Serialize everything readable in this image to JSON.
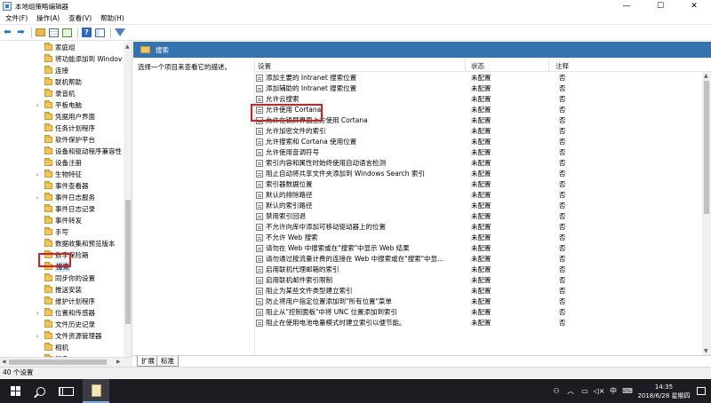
{
  "window": {
    "title": "本地组策略编辑器",
    "controls": {
      "minimize": "—",
      "maximize": "☐",
      "close": "✕"
    }
  },
  "menu": [
    "文件(F)",
    "操作(A)",
    "查看(V)",
    "帮助(H)"
  ],
  "tree": {
    "items": [
      {
        "label": "家庭组",
        "expandable": false
      },
      {
        "label": "将功能添加到 Windov",
        "expandable": false
      },
      {
        "label": "连接",
        "expandable": false
      },
      {
        "label": "联机帮助",
        "expandable": false
      },
      {
        "label": "录音机",
        "expandable": false
      },
      {
        "label": "平板电脑",
        "expandable": true
      },
      {
        "label": "凭据用户界面",
        "expandable": false
      },
      {
        "label": "任务计划程序",
        "expandable": false
      },
      {
        "label": "软件保护平台",
        "expandable": false
      },
      {
        "label": "设备和驱动程序兼容性",
        "expandable": false
      },
      {
        "label": "设备注册",
        "expandable": false
      },
      {
        "label": "生物特征",
        "expandable": true
      },
      {
        "label": "事件查看器",
        "expandable": false
      },
      {
        "label": "事件日志服务",
        "expandable": true
      },
      {
        "label": "事件日志记录",
        "expandable": false
      },
      {
        "label": "事件转发",
        "expandable": false
      },
      {
        "label": "手写",
        "expandable": false
      },
      {
        "label": "数据收集和预览版本",
        "expandable": false
      },
      {
        "label": "数字保险箱",
        "expandable": false
      },
      {
        "label": "搜索",
        "expandable": false,
        "selected": true
      },
      {
        "label": "同步你的设置",
        "expandable": false
      },
      {
        "label": "推送安装",
        "expandable": false
      },
      {
        "label": "维护计划程序",
        "expandable": false
      },
      {
        "label": "位置和传感器",
        "expandable": true
      },
      {
        "label": "文件历史记录",
        "expandable": false
      },
      {
        "label": "文件资源管理器",
        "expandable": true
      },
      {
        "label": "相机",
        "expandable": false
      },
      {
        "label": "消息",
        "expandable": false
      }
    ]
  },
  "right": {
    "header_title": "搜索",
    "description": "选择一个项目来查看它的描述。",
    "columns": {
      "name": "设置",
      "state": "状态",
      "note": "注释"
    },
    "policies": [
      {
        "name": "添加主要的 Intranet 搜索位置",
        "state": "未配置",
        "note": "否"
      },
      {
        "name": "添加辅助的 Intranet 搜索位置",
        "state": "未配置",
        "note": "否"
      },
      {
        "name": "允许云搜索",
        "state": "未配置",
        "note": "否"
      },
      {
        "name": "允许使用 Cortana",
        "state": "未配置",
        "note": "否"
      },
      {
        "name": "允许在锁屏界面上方使用 Cortana",
        "state": "未配置",
        "note": "否"
      },
      {
        "name": "允许加密文件的索引",
        "state": "未配置",
        "note": "否"
      },
      {
        "name": "允许搜索和 Cortana 使用位置",
        "state": "未配置",
        "note": "否"
      },
      {
        "name": "允许使用音调符号",
        "state": "未配置",
        "note": "否"
      },
      {
        "name": "索引内容和属性时始终使用自动语言检测",
        "state": "未配置",
        "note": "否"
      },
      {
        "name": "阻止自动将共享文件夹添加到 Windows Search 索引",
        "state": "未配置",
        "note": "否"
      },
      {
        "name": "索引器数据位置",
        "state": "未配置",
        "note": "否"
      },
      {
        "name": "默认的排除路径",
        "state": "未配置",
        "note": "否"
      },
      {
        "name": "默认的索引路径",
        "state": "未配置",
        "note": "否"
      },
      {
        "name": "禁用索引回退",
        "state": "未配置",
        "note": "否"
      },
      {
        "name": "不允许向库中添加可移动驱动器上的位置",
        "state": "未配置",
        "note": "否"
      },
      {
        "name": "不允许 Web 搜索",
        "state": "未配置",
        "note": "否"
      },
      {
        "name": "请勿在 Web 中搜索或在\"搜索\"中显示 Web 结果",
        "state": "未配置",
        "note": "否"
      },
      {
        "name": "请勿通过按流量计费的连接在 Web 中搜索或在\"搜索\"中显...",
        "state": "未配置",
        "note": "否"
      },
      {
        "name": "启用联机代理邮箱的索引",
        "state": "未配置",
        "note": "否"
      },
      {
        "name": "启用联机邮件索引限制",
        "state": "未配置",
        "note": "否"
      },
      {
        "name": "阻止为某些文件类型建立索引",
        "state": "未配置",
        "note": "否"
      },
      {
        "name": "防止将用户指定位置添加到\"所有位置\"菜单",
        "state": "未配置",
        "note": "否"
      },
      {
        "name": "阻止从\"控制面板\"中将 UNC 位置添加到索引",
        "state": "未配置",
        "note": "否"
      },
      {
        "name": "阻止在使用电池电量模式时建立索引以便节能。",
        "state": "未配置",
        "note": "否"
      }
    ]
  },
  "tabs": [
    "扩展",
    "标准"
  ],
  "status_text": "40 个设置",
  "taskbar": {
    "tray_ime": "中",
    "clock_time": "14:35",
    "clock_date": "2018/6/28 星期四"
  }
}
